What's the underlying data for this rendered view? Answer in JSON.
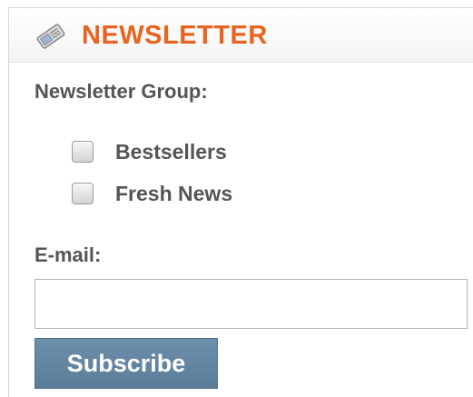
{
  "widget": {
    "title": "NEWSLETTER",
    "icon": "newspaper-icon",
    "accent_color": "#e8641f"
  },
  "form": {
    "group_label": "Newsletter Group:",
    "options": [
      {
        "label": "Bestsellers",
        "checked": false
      },
      {
        "label": "Fresh News",
        "checked": false
      }
    ],
    "email_label": "E-mail:",
    "email_value": "",
    "subscribe_label": "Subscribe",
    "button_color": "#6283a0"
  }
}
